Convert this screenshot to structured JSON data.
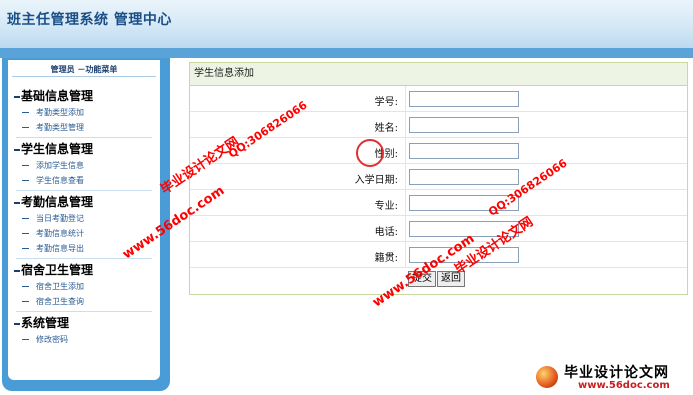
{
  "header": {
    "title": "班主任管理系统 管理中心"
  },
  "sidebar": {
    "title": "管理员 －功能菜单",
    "sections": [
      {
        "title": "基础信息管理",
        "items": [
          "考勤类型添加",
          "考勤类型管理"
        ]
      },
      {
        "title": "学生信息管理",
        "items": [
          "添加学生信息",
          "学生信息查看"
        ]
      },
      {
        "title": "考勤信息管理",
        "items": [
          "当日考勤登记",
          "考勤信息统计",
          "考勤信息导出"
        ]
      },
      {
        "title": "宿舍卫生管理",
        "items": [
          "宿舍卫生添加",
          "宿舍卫生查询"
        ]
      },
      {
        "title": "系统管理",
        "items": [
          "修改密码"
        ]
      }
    ]
  },
  "form": {
    "heading": "学生信息添加",
    "fields": [
      {
        "label": "学号:",
        "value": ""
      },
      {
        "label": "姓名:",
        "value": ""
      },
      {
        "label": "性别:",
        "value": ""
      },
      {
        "label": "入学日期:",
        "value": ""
      },
      {
        "label": "专业:",
        "value": ""
      },
      {
        "label": "电话:",
        "value": ""
      },
      {
        "label": "籍贯:",
        "value": ""
      }
    ],
    "submit_label": "提交",
    "back_label": "返回"
  },
  "watermarks": {
    "url": "www.56doc.com",
    "name": "毕业设计论文网",
    "qq": "QQ:306826066"
  },
  "logo": {
    "title": "毕业设计论文网",
    "url": "www.56doc.com"
  },
  "colors": {
    "accent": "#4a9cd6",
    "watermark": "#ff0000"
  }
}
